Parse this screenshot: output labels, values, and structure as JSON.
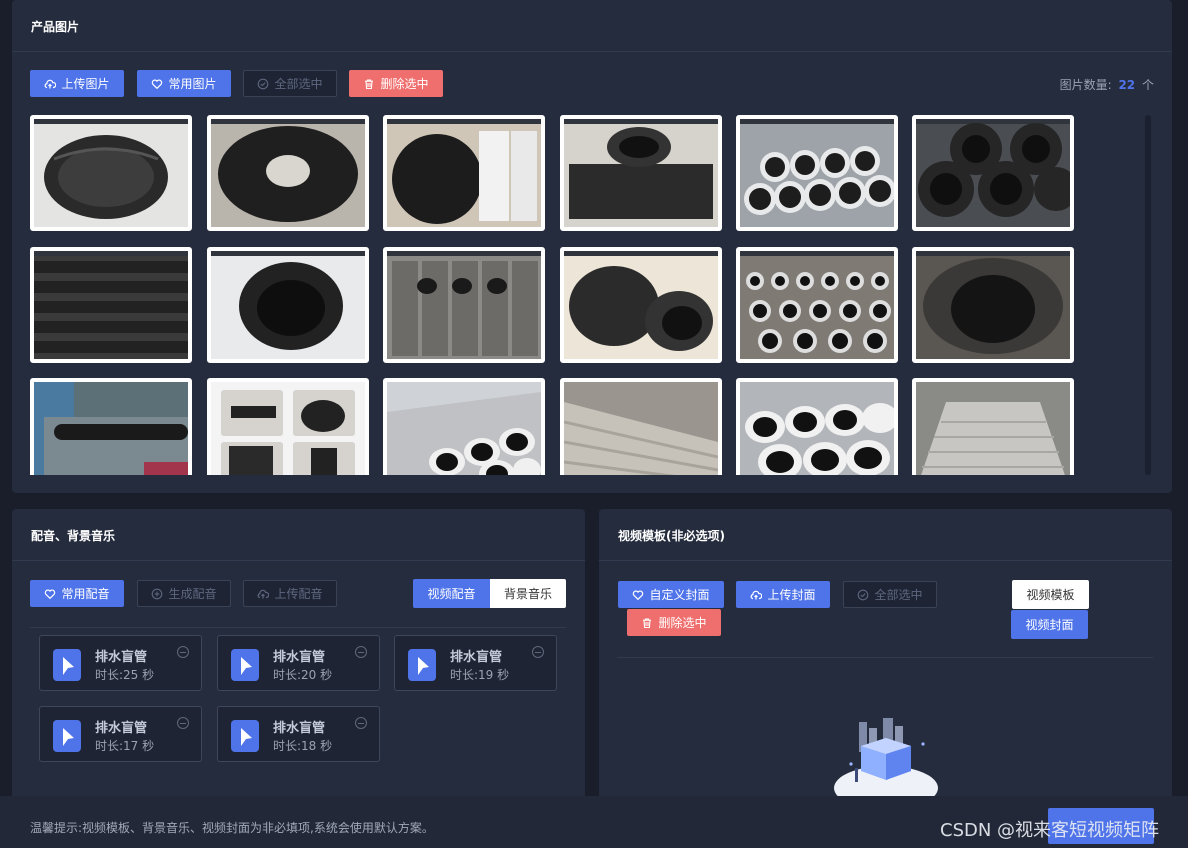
{
  "photos": {
    "title": "产品图片",
    "buttons": {
      "upload": "上传图片",
      "common": "常用图片",
      "select_all": "全部选中",
      "delete_selected": "删除选中"
    },
    "count_label": "图片数量:",
    "count": "22",
    "count_unit": "个"
  },
  "audio": {
    "title": "配音、背景音乐",
    "buttons": {
      "common": "常用配音",
      "generate": "生成配音",
      "upload": "上传配音"
    },
    "tabs": {
      "voiceover": "视频配音",
      "bgm": "背景音乐"
    },
    "items": [
      {
        "name": "排水盲管",
        "duration": "时长:25 秒"
      },
      {
        "name": "排水盲管",
        "duration": "时长:20 秒"
      },
      {
        "name": "排水盲管",
        "duration": "时长:19 秒"
      },
      {
        "name": "排水盲管",
        "duration": "时长:17 秒"
      },
      {
        "name": "排水盲管",
        "duration": "时长:18 秒"
      }
    ]
  },
  "template": {
    "title": "视频模板(非必选项)",
    "buttons": {
      "custom_cover": "自定义封面",
      "upload_cover": "上传封面",
      "select_all": "全部选中",
      "delete_selected": "删除选中"
    },
    "tabs": {
      "template": "视频模板",
      "cover": "视频封面"
    }
  },
  "footer": {
    "tip": "温馨提示:视频模板、背景音乐、视频封面为非必填项,系统会使用默认方案。",
    "watermark": "CSDN @视来客短视频矩阵"
  },
  "colors": {
    "accent": "#4f74ea",
    "danger": "#ef6e6e",
    "panel": "#252c3d",
    "background": "#1a1e2b"
  }
}
